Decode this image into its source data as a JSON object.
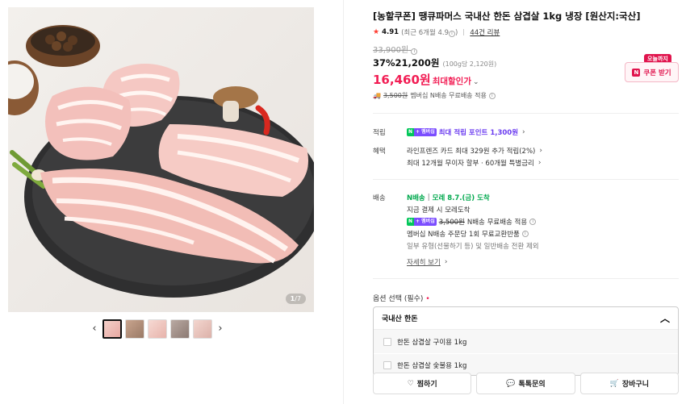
{
  "gallery": {
    "counter_current": "1",
    "counter_total": "/7",
    "thumbnail_count": 5,
    "active_thumbnail": 1,
    "prev_icon": "chevron-left-icon",
    "next_icon": "chevron-right-icon"
  },
  "product": {
    "title": "[농할쿠폰] 땡큐파머스 국내산 한돈 삼겹살 1kg 냉장 [원산지:국산]",
    "rating": "4.91",
    "rating_note": "(최근 6개월 4.9",
    "rating_note_end": ")",
    "review_count": "44건 리뷰",
    "original_price": "33,900원",
    "discount_rate": "37%",
    "sale_price": "21,200원",
    "unit_price": "(100g당 2,120원)",
    "max_discount_price": "16,460원",
    "max_discount_label": "최대할인가",
    "shipping_original": "3,500원",
    "shipping_text": "멤버십 N배송 무료배송 적용"
  },
  "coupon": {
    "badge": "오늘까지",
    "n_letter": "N",
    "label": "쿠폰 받기"
  },
  "points": {
    "label": "적립",
    "text": "최대 적립 포인트 1,300원"
  },
  "benefits": {
    "label": "혜택",
    "line1": "라인프렌즈 카드 최대 329원 추가 적립(2%)",
    "line2": "최대 12개월 무이자 할부 · 60개월 특별금리"
  },
  "delivery": {
    "label": "배송",
    "tag": "N배송",
    "arrival": "모레 8.7.(금) 도착",
    "pay_note": "지금 결제 시 모레도착",
    "shipping_original": "3,500원",
    "shipping_text": "N배송 무료배송 적용",
    "return_text": "멤버십 N배송 주문당 1회 무료교환반품",
    "exclusion": "일부 유형(선물하기 등) 및 일반배송 전환 제외",
    "details_link": "자세히 보기"
  },
  "options": {
    "label": "옵션 선택 (필수)",
    "required_mark": "•",
    "selected_group": "국내산 한돈",
    "items": [
      "한돈 삼겹살 구이용 1kg",
      "한돈 삼겹살 숯불용 1kg"
    ]
  },
  "actions": {
    "wishlist": "찜하기",
    "inquiry": "톡톡문의",
    "cart": "장바구니"
  },
  "colors": {
    "accent": "#f21d54",
    "points": "#6b3cf0",
    "delivery": "#03a94f"
  }
}
